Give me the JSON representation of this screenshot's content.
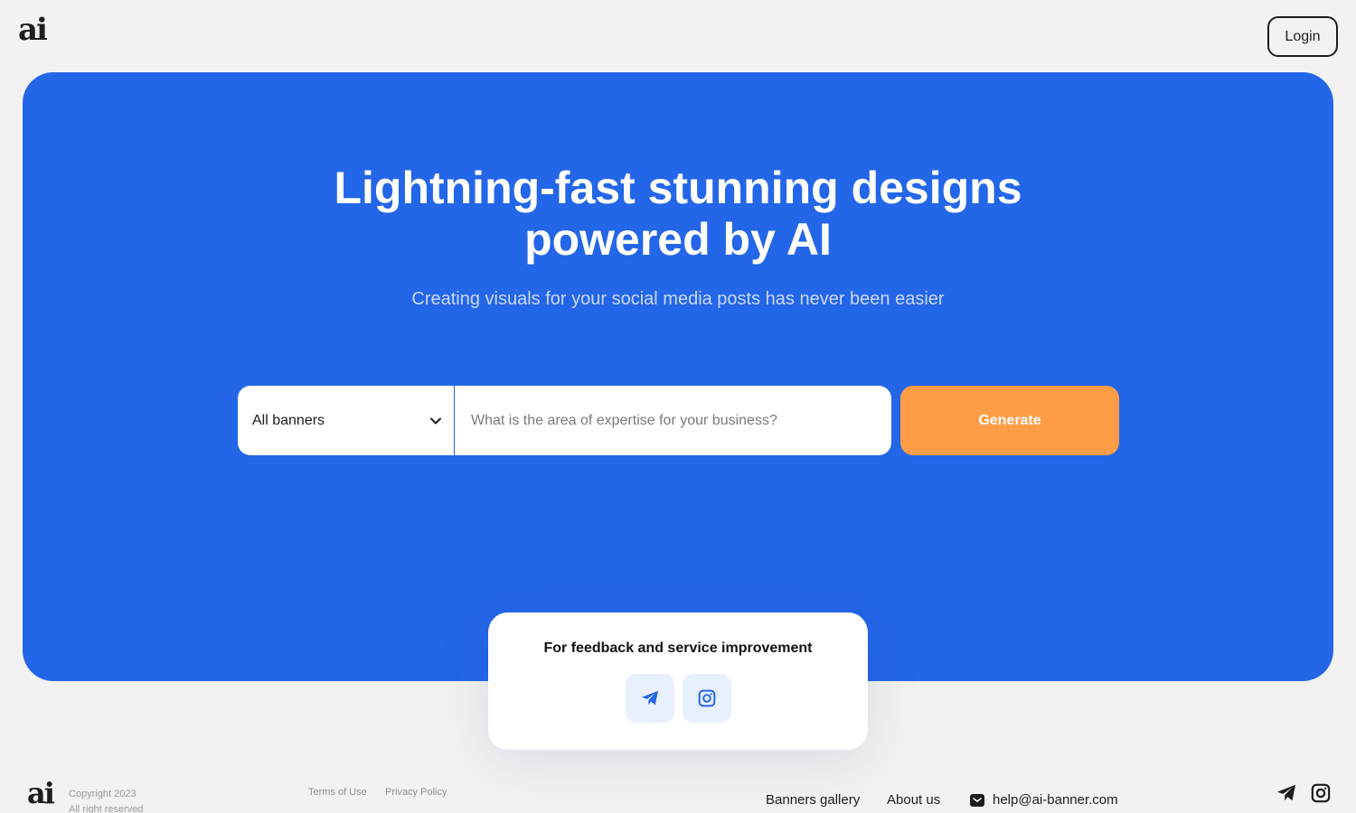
{
  "header": {
    "logo_text": "ai",
    "login_label": "Login"
  },
  "hero": {
    "title_line1": "Lightning-fast stunning designs",
    "title_line2": "powered by AI",
    "subtitle": "Creating visuals for your social media posts has never been easier",
    "category_select": {
      "selected": "All banners"
    },
    "query_input": {
      "value": "",
      "placeholder": "What is the area of expertise for your business?"
    },
    "generate_label": "Generate"
  },
  "feedback": {
    "title": "For feedback and service improvement",
    "buttons": [
      {
        "icon": "telegram-icon"
      },
      {
        "icon": "instagram-icon"
      }
    ]
  },
  "footer": {
    "logo_text": "ai",
    "copyright_line1": "Copyright 2023",
    "copyright_line2": "All right reserved",
    "terms_label": "Terms of Use",
    "privacy_label": "Privacy Policy",
    "nav": [
      {
        "label": "Banners gallery"
      },
      {
        "label": "About us"
      }
    ],
    "email": "help@ai-banner.com",
    "social": [
      "telegram-icon",
      "instagram-icon"
    ]
  },
  "colors": {
    "primary": "#2466e8",
    "accent": "#ff9c46",
    "background": "#f2f2f2"
  }
}
